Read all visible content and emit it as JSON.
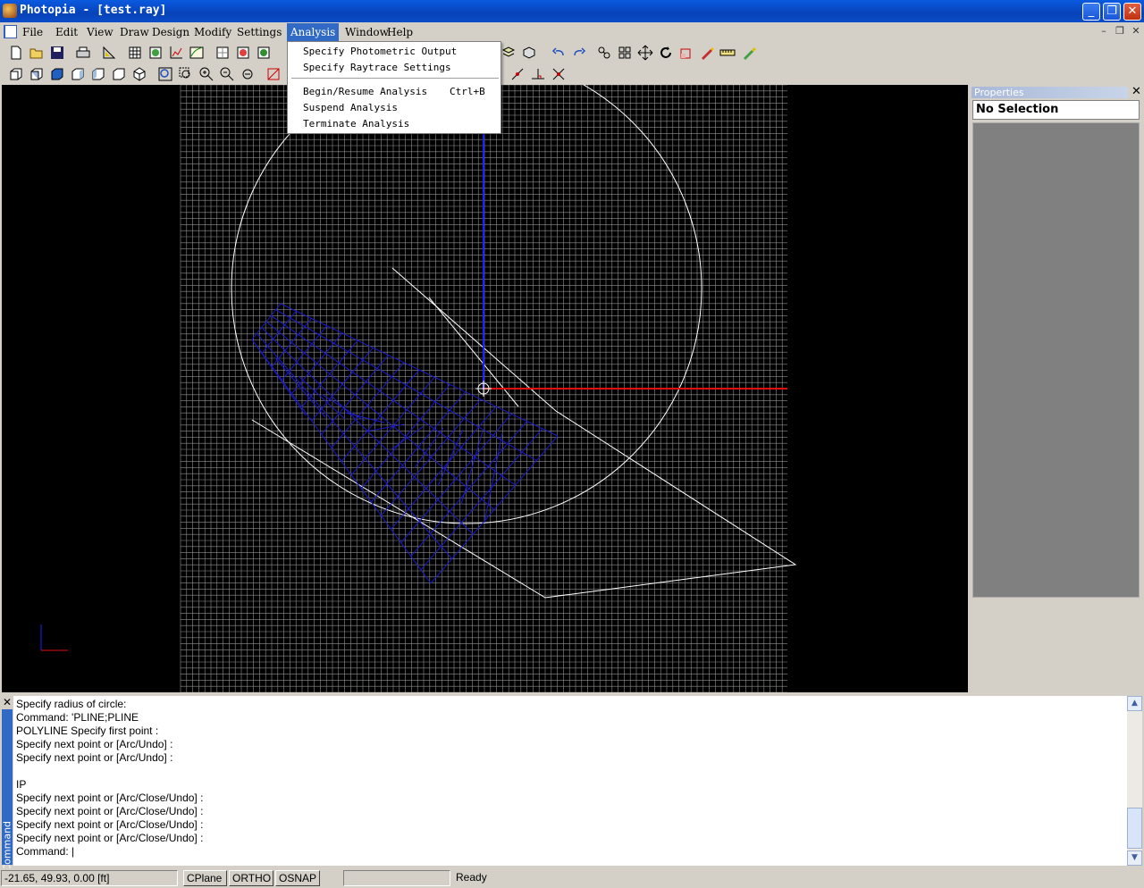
{
  "window": {
    "title": "Photopia - [test.ray]"
  },
  "menubar": {
    "items": [
      "File",
      "Edit",
      "View",
      "Draw",
      "Design",
      "Modify",
      "Settings",
      "Analysis",
      "Window",
      "Help"
    ],
    "active": "Analysis"
  },
  "analysis_menu": {
    "items": [
      {
        "label": "Specify Photometric Output",
        "shortcut": ""
      },
      {
        "label": "Specify Raytrace Settings",
        "shortcut": ""
      },
      {
        "label": "Begin/Resume Analysis",
        "shortcut": "Ctrl+B"
      },
      {
        "label": "Suspend Analysis",
        "shortcut": ""
      },
      {
        "label": "Terminate Analysis",
        "shortcut": ""
      }
    ]
  },
  "properties": {
    "title": "Properties",
    "selection": "No Selection"
  },
  "command": {
    "tab_label": "Command",
    "lines": [
      "Specify radius of circle:",
      "Command: 'PLINE;PLINE",
      "POLYLINE Specify first point :",
      "Specify next point or [Arc/Undo] :",
      "Specify next point or [Arc/Undo] :",
      "",
      "IP",
      "Specify next point or [Arc/Close/Undo] :",
      "Specify next point or [Arc/Close/Undo] :",
      "Specify next point or [Arc/Close/Undo] :",
      "Specify next point or [Arc/Close/Undo] :",
      "Command: |"
    ]
  },
  "status": {
    "coords": "-21.65,  49.93,   0.00 [ft]",
    "cplane": "CPlane",
    "ortho": "ORTHO",
    "osnap": "OSNAP",
    "state": "Ready"
  },
  "colors": {
    "grid": "#909090",
    "geometry_blue": "#1a1ac8",
    "axis_red": "#e01010",
    "axis_blue": "#2020ff",
    "wire_white": "#ffffff",
    "menu_highlight": "#316ac5"
  },
  "icons": {
    "file_toolbar": [
      "new-file-icon",
      "open-folder-icon",
      "save-disk-icon",
      "print-icon",
      "measure-icon",
      "grid-icon",
      "lamp-icon",
      "chart-icon",
      "curve-icon"
    ],
    "view_toolbar": [
      "undo-icon",
      "redo-icon",
      "pan-icon",
      "tiles-icon",
      "move-icon",
      "rotate-icon",
      "scale-icon",
      "pen-icon",
      "ruler-icon",
      "pencil-icon"
    ]
  }
}
